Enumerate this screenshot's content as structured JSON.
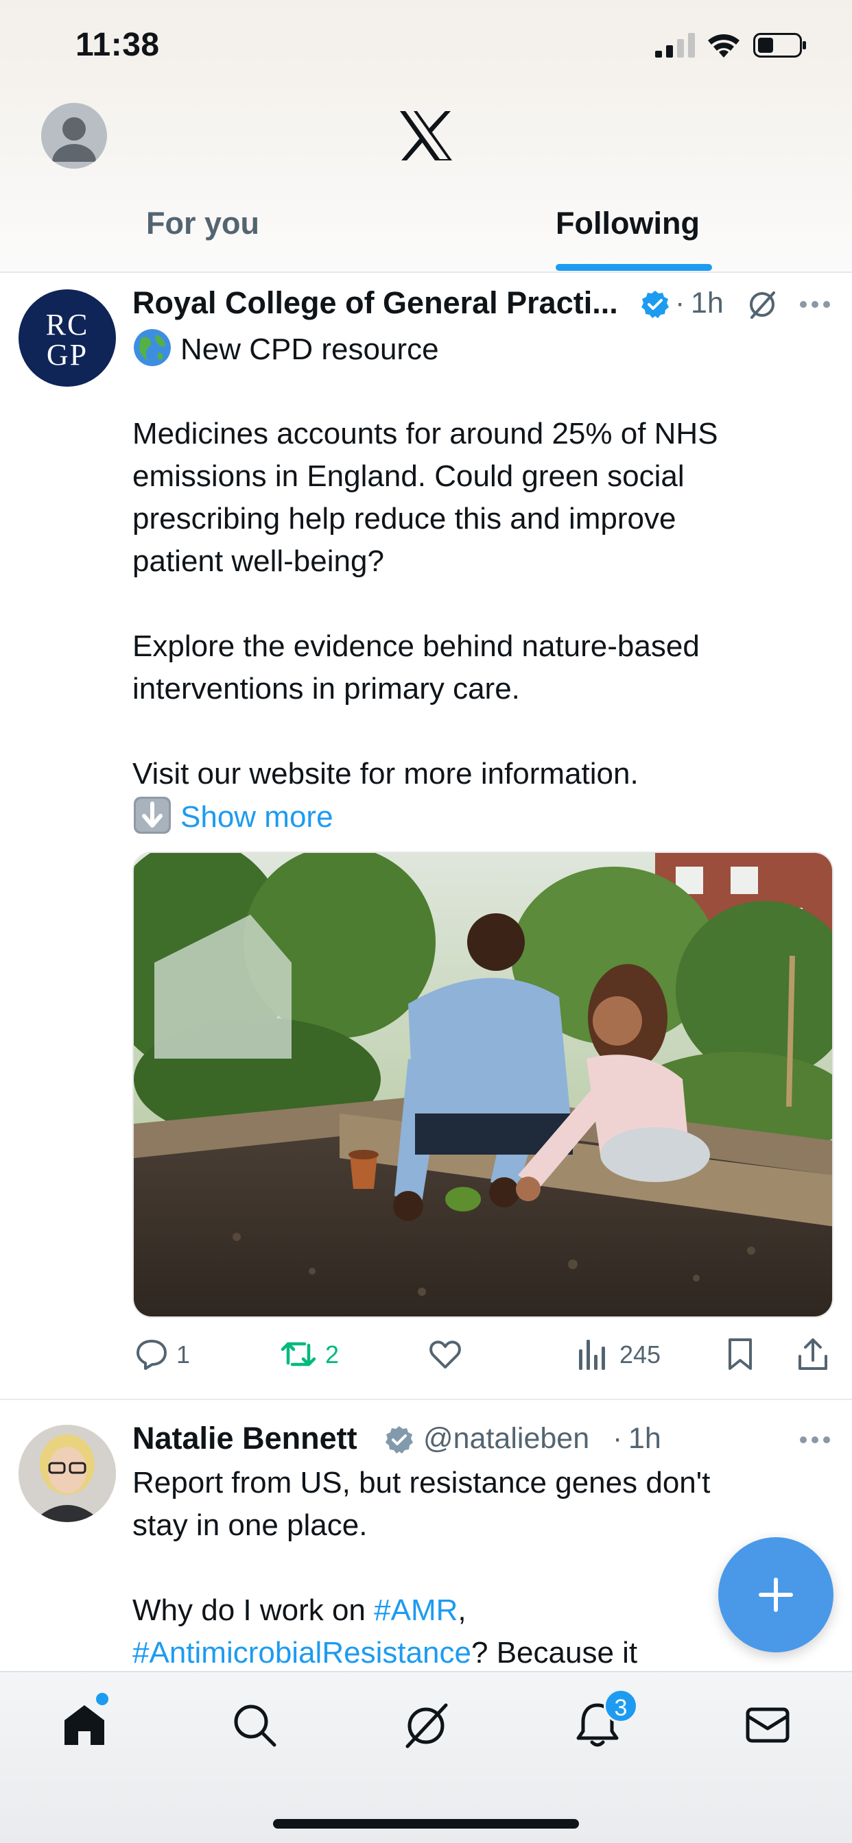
{
  "status_bar": {
    "time": "11:38"
  },
  "header": {
    "tabs": [
      {
        "label": "For you",
        "active": false
      },
      {
        "label": "Following",
        "active": true
      }
    ]
  },
  "tweets": [
    {
      "author": "Royal College of General Practi...",
      "avatar_text_1": "RC",
      "avatar_text_2": "GP",
      "verified": true,
      "separator": "·",
      "time": "1h",
      "lines": [
        "New CPD resource",
        "",
        "Medicines accounts for around 25% of NHS",
        "emissions in England. Could green social",
        "prescribing help reduce this and improve",
        "patient well-being?",
        "",
        "Explore the evidence behind nature-based",
        "interventions in primary care.",
        "",
        "Visit our website for more information."
      ],
      "show_more": "Show more",
      "image_alt": "Adult and child planting seedlings in a raised garden bed",
      "stats": {
        "replies": "1",
        "reposts": "2",
        "views": "245"
      }
    },
    {
      "author": "Natalie Bennett",
      "handle": "@natalieben",
      "separator": "·",
      "time": "1h",
      "verified": true,
      "line1": "Report from US, but resistance genes don't",
      "line2": "stay in one place.",
      "line3_pre": "Why do I work on ",
      "hashtag1": "#AMR",
      "line3_post": ",",
      "hashtag2": "#AntimicrobialResistance",
      "line4_post": "? Because it"
    }
  ],
  "bottom_nav": {
    "notifications_badge": "3"
  },
  "colors": {
    "accent": "#1d9bf0",
    "repost_green": "#00ba7c",
    "muted": "#536471",
    "fab": "#4a99e9"
  },
  "icons": [
    "signal-icon",
    "wifi-icon",
    "battery-icon",
    "x-logo-icon",
    "verified-icon",
    "grok-icon",
    "more-icon",
    "globe-emoji-icon",
    "down-arrow-emoji-icon",
    "reply-icon",
    "repost-icon",
    "like-icon",
    "views-icon",
    "bookmark-icon",
    "share-icon",
    "compose-icon",
    "home-icon",
    "search-icon",
    "grok-nav-icon",
    "notifications-icon",
    "messages-icon"
  ]
}
